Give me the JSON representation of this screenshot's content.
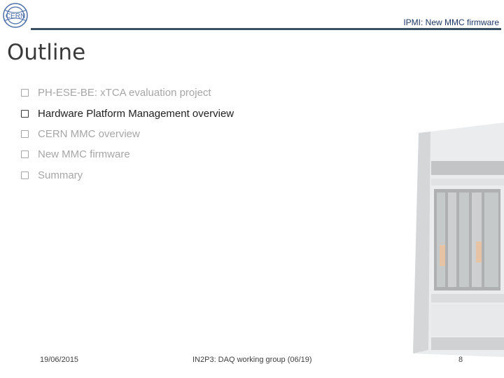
{
  "header": {
    "title": "IPMI: New MMC firmware",
    "logo_icon": "cern-logo-icon"
  },
  "page_title": "Outline",
  "outline": [
    {
      "label": "PH-ESE-BE: xTCA evaluation project",
      "state": "dim"
    },
    {
      "label": "Hardware Platform Management overview",
      "state": "active"
    },
    {
      "label": "CERN MMC overview",
      "state": "dim"
    },
    {
      "label": "New MMC firmware",
      "state": "dim"
    },
    {
      "label": "Summary",
      "state": "dim"
    }
  ],
  "footer": {
    "date": "19/06/2015",
    "center": "IN2P3: DAQ working group (06/19)",
    "page": "8"
  },
  "colors": {
    "header_rule": "#3b4f63",
    "logo": "#4a6ea8",
    "active_text": "#1f1f1f",
    "dim_text": "#a6a6a6"
  }
}
